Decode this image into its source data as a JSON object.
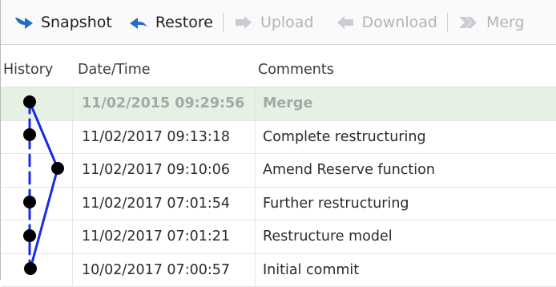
{
  "toolbar": {
    "snapshot_label": "Snapshot",
    "restore_label": "Restore",
    "upload_label": "Upload",
    "download_label": "Download",
    "merge_label": "Merg"
  },
  "table": {
    "columns": [
      "History",
      "Date/Time",
      "Comments"
    ],
    "rows": [
      {
        "datetime": "11/02/2015 09:29:56",
        "comment": "Merge"
      },
      {
        "datetime": "11/02/2017 09:13:18",
        "comment": "Complete restructuring"
      },
      {
        "datetime": "11/02/2017 09:10:06",
        "comment": "Amend Reserve function"
      },
      {
        "datetime": "11/02/2017 07:01:54",
        "comment": "Further restructuring"
      },
      {
        "datetime": "11/02/2017 07:01:21",
        "comment": "Restructure model"
      },
      {
        "datetime": "10/02/2017 07:00:57",
        "comment": "Initial commit"
      }
    ]
  },
  "colors": {
    "accent_blue": "#1f6fc2",
    "graph_line": "#1a2ce0",
    "selected_row": "#e4f1e4"
  },
  "icons": [
    "snapshot-arrow-icon",
    "restore-arrow-icon",
    "upload-icon",
    "download-icon",
    "merge-icon"
  ]
}
